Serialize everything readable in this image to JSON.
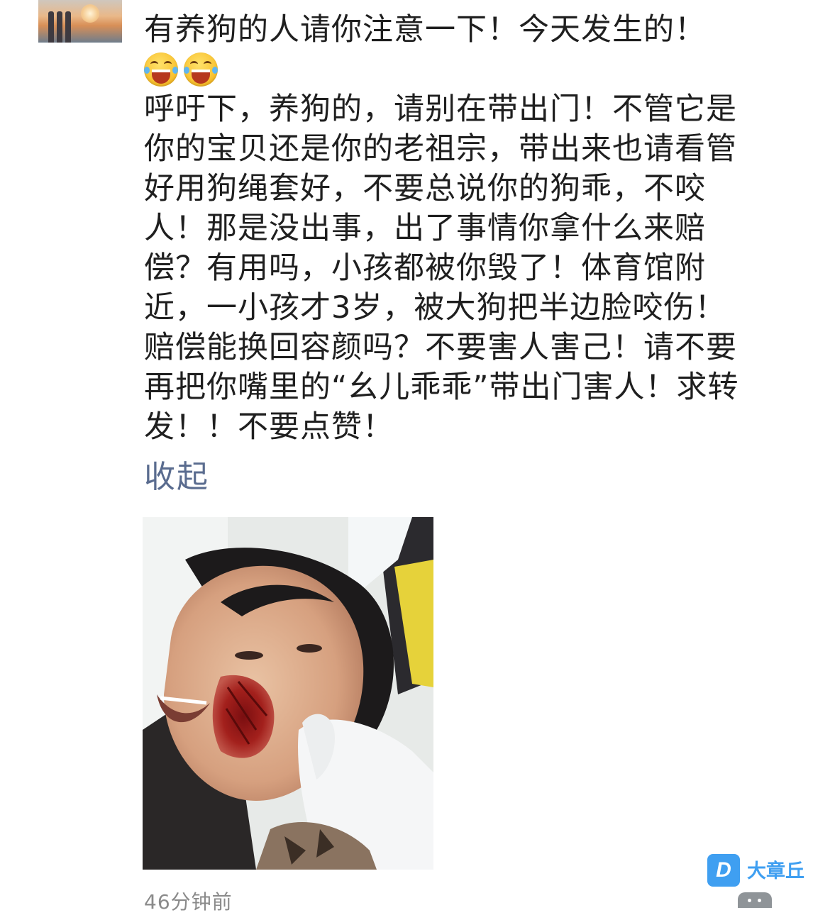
{
  "post": {
    "title": "有养狗的人请你注意一下！今天发生的！",
    "emojis": [
      {
        "icon": "laughing-tears-emoji-icon"
      },
      {
        "icon": "laughing-tears-emoji-icon"
      }
    ],
    "body_lines": [
      "呼吁下，养狗的，请别在带出门！不管它是",
      "你的宝贝还是你的老祖宗，带出来也请看管",
      "好用狗绳套好，不要总说你的狗乖，不咬",
      "人！那是没出事，出了事情你拿什么来赔",
      "偿？有用吗，小孩都被你毁了！体育馆附",
      "近，一小孩才3岁，被大狗把半边脸咬伤！",
      "赔偿能换回容颜吗？不要害人害己！请不要",
      "再把你嘴里的“幺儿乖乖”带出门害人！求转",
      "发！！不要点赞！"
    ],
    "collapse_label": "收起",
    "timestamp": "46分钟前"
  },
  "watermark": {
    "badge": "D",
    "text": "大章丘"
  },
  "colors": {
    "text": "#1f1f1f",
    "link": "#5a6c8f",
    "meta": "#8a8a8a",
    "watermark": "#3f9ff1"
  }
}
